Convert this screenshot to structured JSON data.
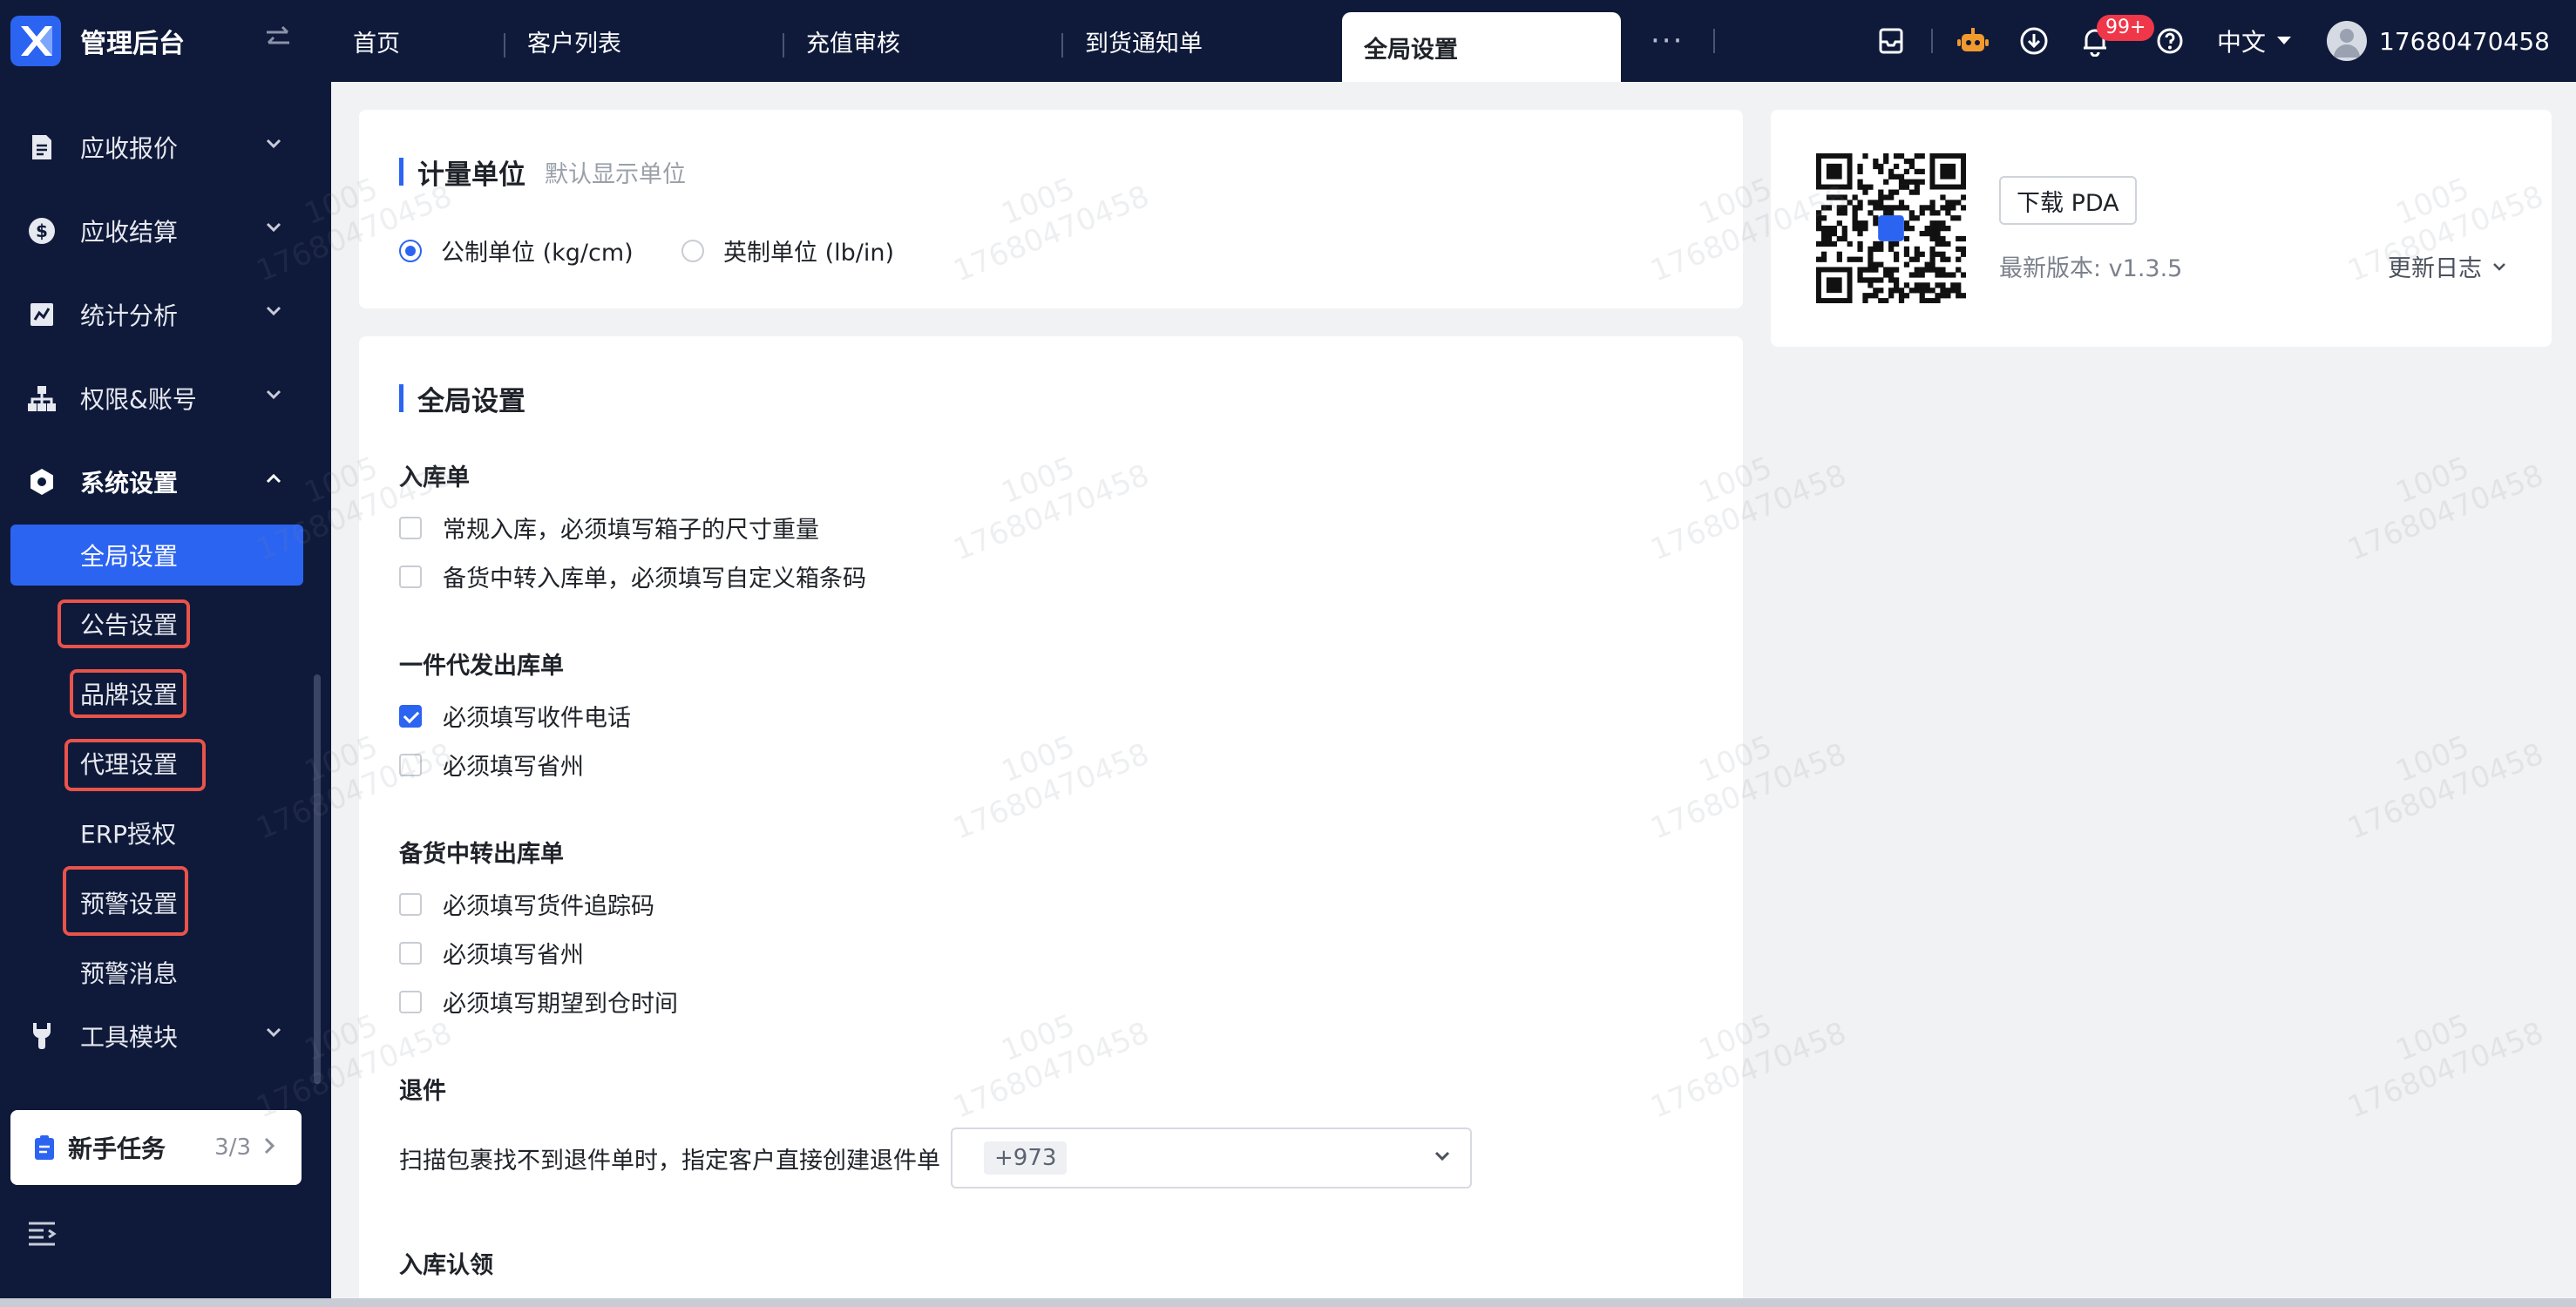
{
  "header": {
    "brand_title": "管理后台",
    "tabs": [
      {
        "label": "首页"
      },
      {
        "label": "客户列表"
      },
      {
        "label": "充值审核"
      },
      {
        "label": "到货通知单"
      },
      {
        "label": "全局设置"
      }
    ],
    "more_label": "···",
    "notification_count": "99+",
    "language": "中文",
    "username": "17680470458"
  },
  "sidebar": {
    "groups": [
      {
        "label": "应收报价"
      },
      {
        "label": "应收结算"
      },
      {
        "label": "统计分析"
      },
      {
        "label": "权限&账号"
      },
      {
        "label": "系统设置"
      },
      {
        "label": "工具模块"
      }
    ],
    "sub_items": [
      {
        "label": "全局设置"
      },
      {
        "label": "公告设置"
      },
      {
        "label": "品牌设置"
      },
      {
        "label": "代理设置"
      },
      {
        "label": "ERP授权"
      },
      {
        "label": "预警设置"
      },
      {
        "label": "预警消息"
      }
    ],
    "task_card": {
      "title": "新手任务",
      "count": "3/3"
    }
  },
  "units": {
    "title": "计量单位",
    "subtitle": "默认显示单位",
    "options": [
      {
        "label": "公制单位 (kg/cm)",
        "selected": true
      },
      {
        "label": "英制单位 (lb/in)",
        "selected": false
      }
    ]
  },
  "global": {
    "title": "全局设置",
    "inbound": {
      "title": "入库单",
      "items": [
        {
          "label": "常规入库，必须填写箱子的尺寸重量",
          "checked": false
        },
        {
          "label": "备货中转入库单，必须填写自定义箱条码",
          "checked": false
        }
      ]
    },
    "dropship": {
      "title": "一件代发出库单",
      "items": [
        {
          "label": "必须填写收件电话",
          "checked": true
        },
        {
          "label": "必须填写省州",
          "checked": false
        }
      ]
    },
    "transfer_out": {
      "title": "备货中转出库单",
      "items": [
        {
          "label": "必须填写货件追踪码",
          "checked": false
        },
        {
          "label": "必须填写省州",
          "checked": false
        },
        {
          "label": "必须填写期望到仓时间",
          "checked": false
        }
      ]
    },
    "returns": {
      "title": "退件",
      "label": "扫描包裹找不到退件单时，指定客户直接创建退件单",
      "selected_tag": "+973"
    },
    "inbound_claim": {
      "title": "入库认领"
    }
  },
  "pda": {
    "download_label": "下载 PDA",
    "version": "最新版本: v1.3.5",
    "changelog": "更新日志"
  },
  "watermark": {
    "line1": "1005",
    "line2": "17680470458"
  },
  "colors": {
    "nav_bg": "#0f1a3a",
    "accent": "#2c64f2",
    "highlight": "#e9534a",
    "badge": "#f0374a"
  }
}
